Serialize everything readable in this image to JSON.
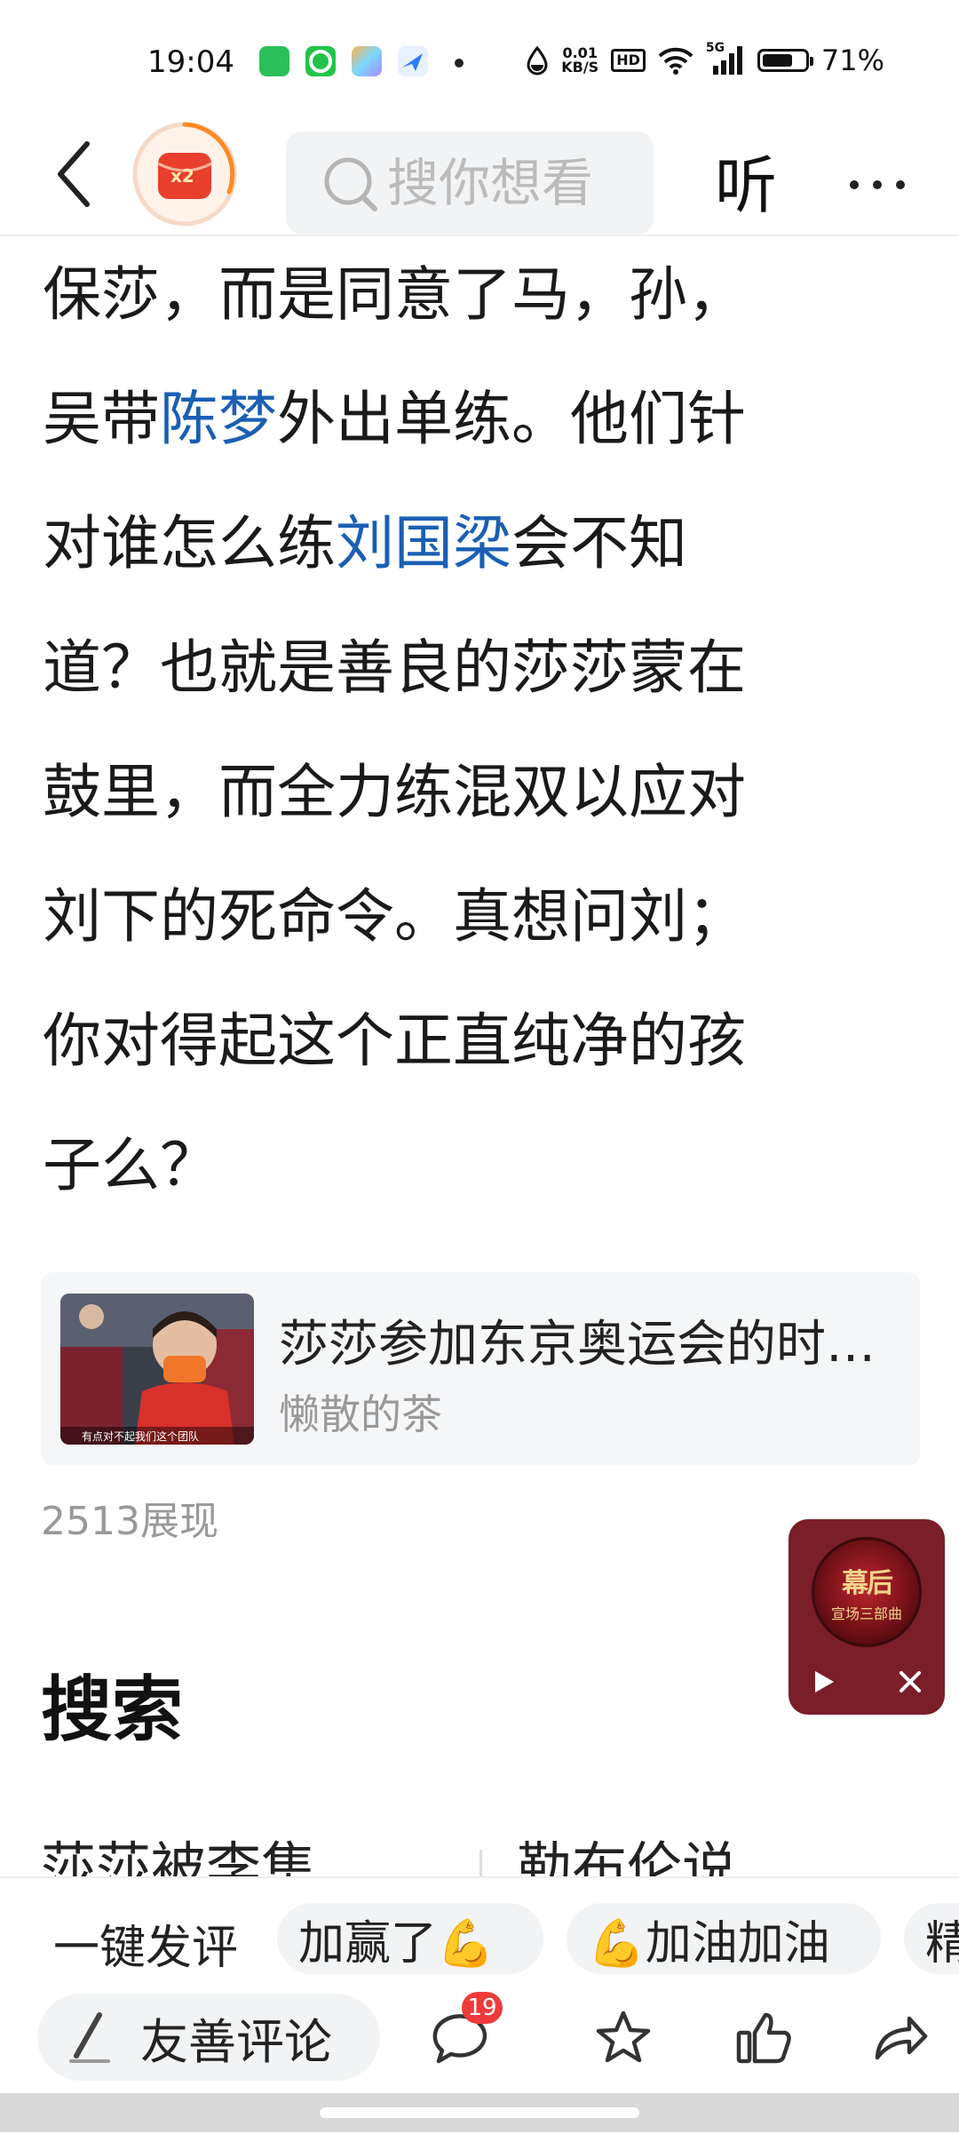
{
  "status_bar": {
    "time": "19:04",
    "net_speed_value": "0.01",
    "net_speed_unit": "KB/S",
    "hd_badge": "HD",
    "signal_label": "5G",
    "battery_percent": "71%",
    "battery_level": 0.71,
    "app_icons": [
      "app-icon-green-grid",
      "app-icon-green-ring",
      "app-icon-rainbow-square",
      "app-icon-blue-plane"
    ]
  },
  "nav": {
    "redpacket_badge": "x2",
    "search_placeholder": "搜你想看",
    "listen_label": "听"
  },
  "article": {
    "lines": [
      [
        {
          "t": "保莎，而是同意了马，孙，"
        }
      ],
      [
        {
          "t": "吴带"
        },
        {
          "t": "陈梦",
          "link": true
        },
        {
          "t": "外出单练。他们针"
        }
      ],
      [
        {
          "t": "对谁怎么练"
        },
        {
          "t": "刘国梁",
          "link": true
        },
        {
          "t": "会不知"
        }
      ],
      [
        {
          "t": "道？也就是善良的莎莎蒙在"
        }
      ],
      [
        {
          "t": "鼓里，而全力练混双以应对"
        }
      ],
      [
        {
          "t": "刘下的死命令。真想问刘；"
        }
      ],
      [
        {
          "t": "你对得起这个正直纯净的孩"
        }
      ],
      [
        {
          "t": "子么？"
        }
      ]
    ]
  },
  "reference": {
    "title": "莎莎参加东京奥运会的时…",
    "author": "懒散的茶",
    "thumb_caption": "有点对不起我们这个团队"
  },
  "views": "2513展现",
  "audio_widget": {
    "cover_title": "幕后",
    "cover_subtitle": "宣场三部曲"
  },
  "search_section": {
    "heading": "搜索",
    "items": [
      "莎莎被李隼",
      "勒布伦说"
    ]
  },
  "quick_comments": {
    "label": "一键发评",
    "chips": [
      "加赢了💪",
      "💪加油加油",
      "精"
    ]
  },
  "comment_bar": {
    "placeholder": "友善评论",
    "comment_count": "19"
  },
  "colors": {
    "link": "#1a5fb4",
    "badge_red": "#ee3a3a",
    "widget_bg": "#7a1e28"
  }
}
